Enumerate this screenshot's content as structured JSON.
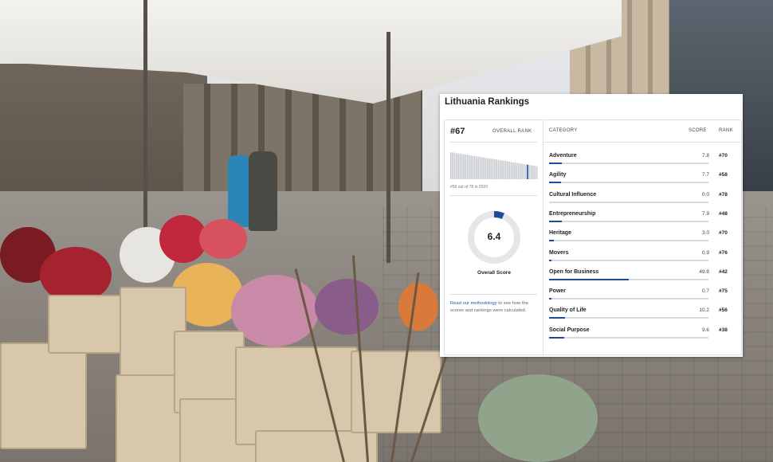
{
  "card": {
    "title": "Lithuania Rankings",
    "overall_rank": "#67",
    "overall_rank_label": "OVERALL RANK",
    "rank_caption": "#59 out of 78 in 2020",
    "score": "6.4",
    "score_fraction": 0.064,
    "score_label": "Overall Score",
    "methodology_link": "Read our methodology",
    "methodology_text": " to see how the scores and rankings were calculated.",
    "accent_color": "#1e4c9a",
    "columns": {
      "category": "CATEGORY",
      "score": "SCORE",
      "rank": "RANK"
    },
    "rankings": [
      {
        "category": "Adventure",
        "score": "7.8",
        "rank": "#70",
        "fraction": 0.078
      },
      {
        "category": "Agility",
        "score": "7.7",
        "rank": "#58",
        "fraction": 0.077
      },
      {
        "category": "Cultural Influence",
        "score": "0.0",
        "rank": "#78",
        "fraction": 0.0
      },
      {
        "category": "Entrepreneurship",
        "score": "7.9",
        "rank": "#48",
        "fraction": 0.079
      },
      {
        "category": "Heritage",
        "score": "3.0",
        "rank": "#70",
        "fraction": 0.03
      },
      {
        "category": "Movers",
        "score": "0.9",
        "rank": "#76",
        "fraction": 0.009
      },
      {
        "category": "Open for Business",
        "score": "49.8",
        "rank": "#42",
        "fraction": 0.498
      },
      {
        "category": "Power",
        "score": "0.7",
        "rank": "#75",
        "fraction": 0.007
      },
      {
        "category": "Quality of Life",
        "score": "10.2",
        "rank": "#56",
        "fraction": 0.102
      },
      {
        "category": "Social Purpose",
        "score": "9.6",
        "rank": "#38",
        "fraction": 0.096
      }
    ],
    "history_highlight_index": 58,
    "history_count": 78
  }
}
